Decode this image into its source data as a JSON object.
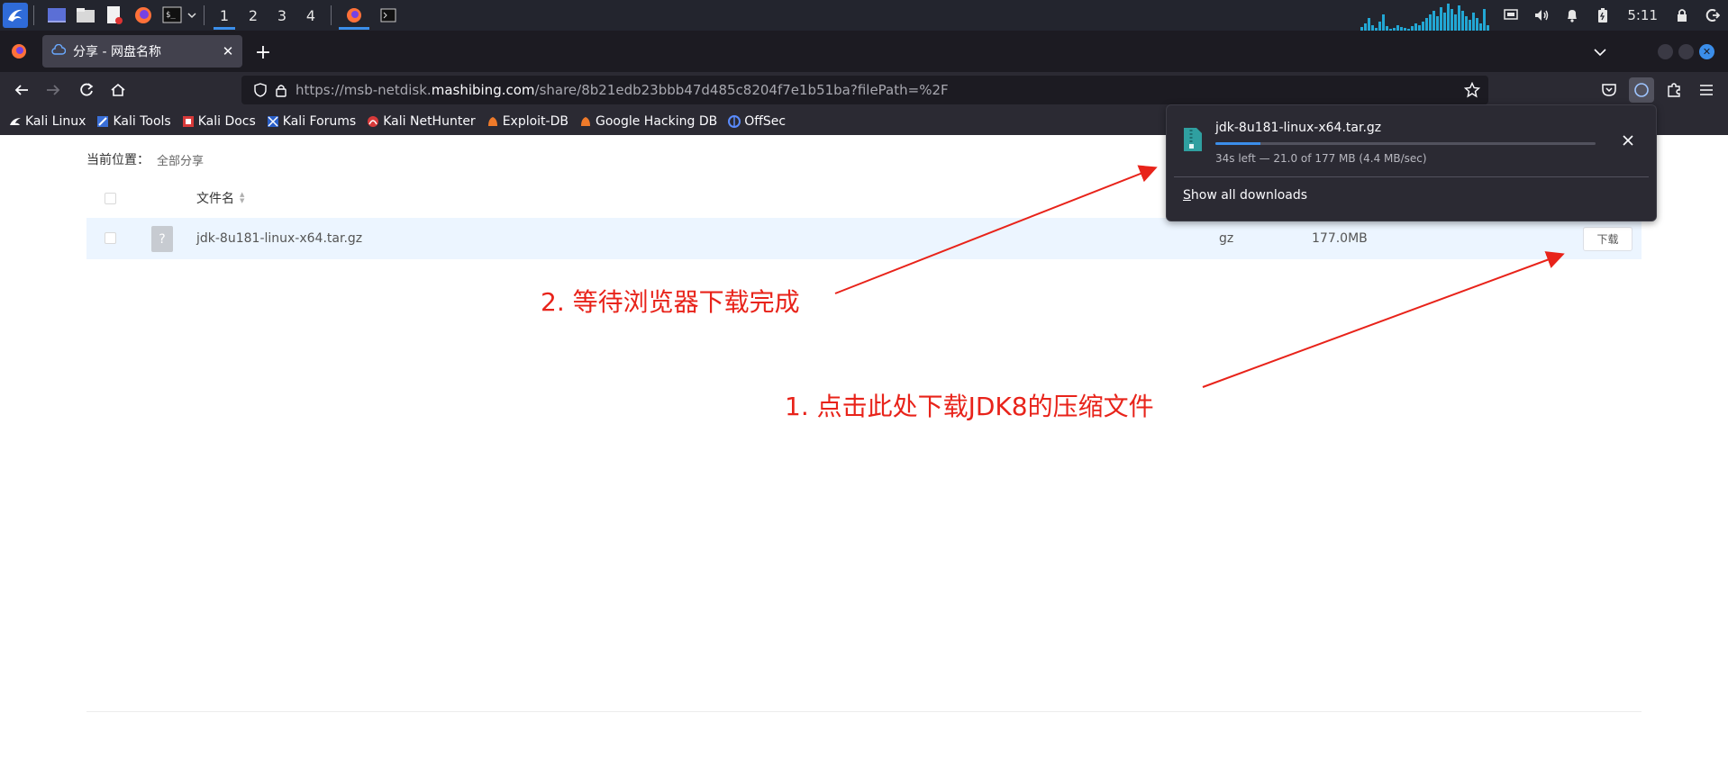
{
  "taskbar": {
    "workspaces": [
      "1",
      "2",
      "3",
      "4"
    ],
    "active_workspace": "1",
    "clock": "5:11"
  },
  "browser": {
    "tab": {
      "title": "分享 - 网盘名称"
    },
    "url": {
      "prefix": "https://msb-netdisk.",
      "domain": "mashibing.com",
      "path": "/share/8b21edb23bbb47d485c8204f7e1b51ba?filePath=%2F"
    },
    "bookmarks": [
      {
        "label": "Kali Linux",
        "icon": "kali-dragon-icon"
      },
      {
        "label": "Kali Tools",
        "icon": "kali-tools-icon"
      },
      {
        "label": "Kali Docs",
        "icon": "kali-docs-icon"
      },
      {
        "label": "Kali Forums",
        "icon": "kali-forums-icon"
      },
      {
        "label": "Kali NetHunter",
        "icon": "nethunter-icon"
      },
      {
        "label": "Exploit-DB",
        "icon": "exploit-db-icon"
      },
      {
        "label": "Google Hacking DB",
        "icon": "ghdb-icon"
      },
      {
        "label": "OffSec",
        "icon": "offsec-icon"
      }
    ]
  },
  "page": {
    "breadcrumb": {
      "label": "当前位置：",
      "value": "全部分享"
    },
    "table": {
      "header_name": "文件名",
      "rows": [
        {
          "name": "jdk-8u181-linux-x64.tar.gz",
          "type": "gz",
          "size": "177.0MB",
          "action": "下载"
        }
      ]
    }
  },
  "annotations": {
    "step1": "1. 点击此处下载JDK8的压缩文件",
    "step2": "2. 等待浏览器下载完成",
    "color": "#e8231a"
  },
  "download_panel": {
    "filename": "jdk-8u181-linux-x64.tar.gz",
    "progress": 0.119,
    "status": "34s left — 21.0 of 177 MB (4.4 MB/sec)",
    "show_all_first": "S",
    "show_all_rest": "how all downloads"
  },
  "colors": {
    "accent": "#3b8eea",
    "chrome_dark": "#1c1b22",
    "row_highlight": "#ecf5ff"
  }
}
